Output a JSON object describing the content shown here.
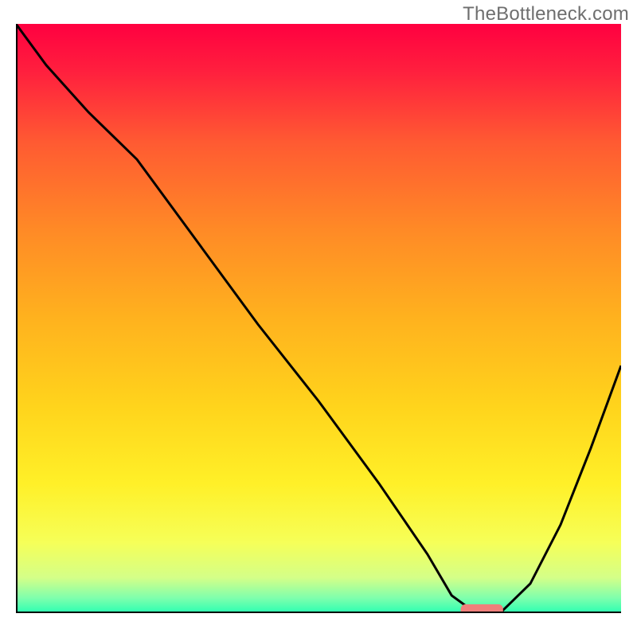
{
  "watermark": "TheBottleneck.com",
  "chart_data": {
    "type": "line",
    "title": "",
    "xlabel": "",
    "ylabel": "",
    "xlim": [
      0,
      100
    ],
    "ylim": [
      0,
      100
    ],
    "legend": false,
    "grid": false,
    "background": {
      "type": "vertical-gradient",
      "stops": [
        {
          "pos": 0.0,
          "color": "#ff0040"
        },
        {
          "pos": 0.08,
          "color": "#ff1f3e"
        },
        {
          "pos": 0.2,
          "color": "#ff5a32"
        },
        {
          "pos": 0.35,
          "color": "#ff8a26"
        },
        {
          "pos": 0.5,
          "color": "#ffb21e"
        },
        {
          "pos": 0.65,
          "color": "#ffd41c"
        },
        {
          "pos": 0.78,
          "color": "#fff028"
        },
        {
          "pos": 0.88,
          "color": "#f6ff58"
        },
        {
          "pos": 0.94,
          "color": "#d4ff88"
        },
        {
          "pos": 0.975,
          "color": "#7dffad"
        },
        {
          "pos": 1.0,
          "color": "#2bffb2"
        }
      ]
    },
    "series": [
      {
        "name": "curve",
        "color": "#000000",
        "x": [
          0,
          5,
          12,
          20,
          30,
          40,
          50,
          60,
          68,
          72,
          76,
          80,
          85,
          90,
          95,
          100
        ],
        "y": [
          100,
          93,
          85,
          77,
          63,
          49,
          36,
          22,
          10,
          3,
          0,
          0,
          5,
          15,
          28,
          42
        ]
      }
    ],
    "markers": [
      {
        "name": "bottleneck-marker",
        "shape": "rounded-rect",
        "color": "#ef7f7b",
        "x_range": [
          73.5,
          80.5
        ],
        "y": 0.5,
        "height": 2.0
      }
    ],
    "axes": {
      "left": {
        "visible": true,
        "color": "#000000",
        "ticks": []
      },
      "bottom": {
        "visible": true,
        "color": "#000000",
        "ticks": []
      },
      "top": {
        "visible": false
      },
      "right": {
        "visible": false
      }
    }
  }
}
